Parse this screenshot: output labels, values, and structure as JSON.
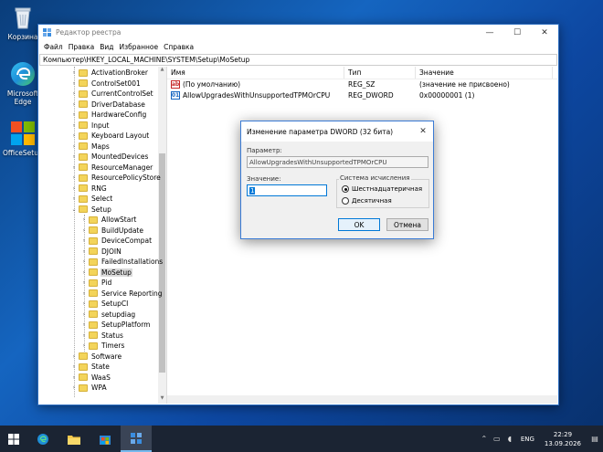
{
  "desktop": {
    "icons": [
      {
        "label": "Корзина",
        "icon": "recycle-bin-icon"
      },
      {
        "label": "Microsoft Edge",
        "icon": "edge-icon"
      },
      {
        "label": "OfficeSetu...",
        "icon": "office-setup-icon"
      }
    ]
  },
  "window": {
    "title": "Редактор реестра",
    "menu": [
      "Файл",
      "Правка",
      "Вид",
      "Избранное",
      "Справка"
    ],
    "address": "Компьютер\\HKEY_LOCAL_MACHINE\\SYSTEM\\Setup\\MoSetup"
  },
  "tree": {
    "items": [
      {
        "label": "ActivationBroker",
        "level": 1
      },
      {
        "label": "ControlSet001",
        "level": 1
      },
      {
        "label": "CurrentControlSet",
        "level": 1
      },
      {
        "label": "DriverDatabase",
        "level": 1
      },
      {
        "label": "HardwareConfig",
        "level": 1
      },
      {
        "label": "Input",
        "level": 1
      },
      {
        "label": "Keyboard Layout",
        "level": 1
      },
      {
        "label": "Maps",
        "level": 1
      },
      {
        "label": "MountedDevices",
        "level": 1
      },
      {
        "label": "ResourceManager",
        "level": 1
      },
      {
        "label": "ResourcePolicyStore",
        "level": 1
      },
      {
        "label": "RNG",
        "level": 1
      },
      {
        "label": "Select",
        "level": 1
      },
      {
        "label": "Setup",
        "level": 1,
        "expanded": true
      },
      {
        "label": "AllowStart",
        "level": 2
      },
      {
        "label": "BuildUpdate",
        "level": 2
      },
      {
        "label": "DeviceCompat",
        "level": 2
      },
      {
        "label": "DJOIN",
        "level": 2
      },
      {
        "label": "FailedInstallations",
        "level": 2
      },
      {
        "label": "MoSetup",
        "level": 2,
        "selected": true
      },
      {
        "label": "Pid",
        "level": 2
      },
      {
        "label": "Service Reporting",
        "level": 2
      },
      {
        "label": "SetupCI",
        "level": 2
      },
      {
        "label": "setupdiag",
        "level": 2
      },
      {
        "label": "SetupPlatform",
        "level": 2
      },
      {
        "label": "Status",
        "level": 2
      },
      {
        "label": "Timers",
        "level": 2
      },
      {
        "label": "Software",
        "level": 1
      },
      {
        "label": "State",
        "level": 1
      },
      {
        "label": "WaaS",
        "level": 1
      },
      {
        "label": "WPA",
        "level": 1
      }
    ]
  },
  "list": {
    "headers": {
      "name": "Имя",
      "type": "Тип",
      "data": "Значение"
    },
    "rows": [
      {
        "name": "(По умолчанию)",
        "type": "REG_SZ",
        "data": "(значение не присвоено)",
        "icon": "string-value-icon"
      },
      {
        "name": "AllowUpgradesWithUnsupportedTPMOrCPU",
        "type": "REG_DWORD",
        "data": "0x00000001 (1)",
        "icon": "dword-value-icon"
      }
    ]
  },
  "dialog": {
    "title": "Изменение параметра DWORD (32 бита)",
    "param_label": "Параметр:",
    "param_value": "AllowUpgradesWithUnsupportedTPMOrCPU",
    "value_label": "Значение:",
    "value": "1",
    "base_label": "Система исчисления",
    "base_hex": "Шестнадцатеричная",
    "base_dec": "Десятичная",
    "base_selected": "hex",
    "ok": "OK",
    "cancel": "Отмена"
  },
  "taskbar": {
    "lang": "ENG",
    "time": "22:29",
    "date": "13.09.2026"
  }
}
